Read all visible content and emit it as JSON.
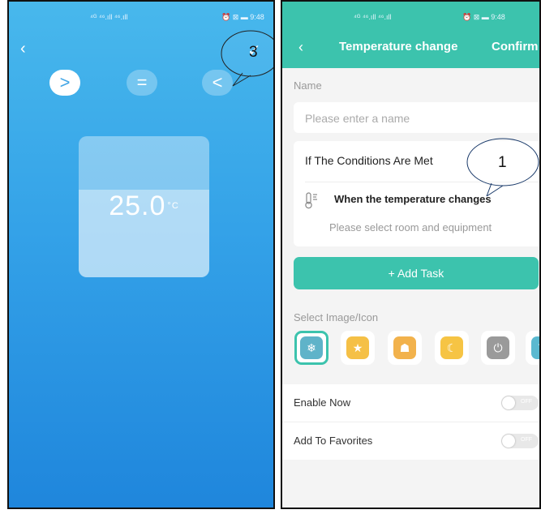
{
  "left_screen": {
    "status_bar": {
      "left": "⁴ᴳ ⁴⁶.ıll ⁴⁶.ıll",
      "right": "⏰ ⊠ ▬ 9:48"
    },
    "back_label": "‹",
    "operators": [
      {
        "symbol": ">",
        "selected": true
      },
      {
        "symbol": "=",
        "selected": false
      },
      {
        "symbol": "<",
        "selected": false
      }
    ],
    "confirm_check": "✓",
    "temperature": {
      "value": "25.0",
      "unit": "°C",
      "level_fraction": 0.62
    },
    "annotation": "3"
  },
  "right_screen": {
    "status_bar": {
      "left": "⁴ᴳ ⁴⁶.ıll ⁴⁶.ıll",
      "right": "⏰ ⊠ ▬ 9:48"
    },
    "header": {
      "back": "‹",
      "title": "Temperature change",
      "confirm": "Confirm"
    },
    "name_label": "Name",
    "name_placeholder": "Please enter a name",
    "conditions": {
      "title": "If The Conditions Are Met",
      "item_text": "When the temperature changes",
      "subtext": "Please select room and equipment"
    },
    "annotation": "1",
    "add_task": "+ Add Task",
    "image_label": "Select Image/Icon",
    "icons": [
      {
        "name": "home-snowflake-icon",
        "glyph": "❄",
        "color": "#5fb3c9",
        "selected": true
      },
      {
        "name": "home-star-icon",
        "glyph": "★",
        "color": "#f5c046",
        "selected": false
      },
      {
        "name": "home-person-icon",
        "glyph": "☗",
        "color": "#f2b24c",
        "selected": false
      },
      {
        "name": "moon-icon",
        "glyph": "☾",
        "color": "#f6c444",
        "selected": false
      },
      {
        "name": "power-icon",
        "glyph": "⏻",
        "color": "#9a9a9a",
        "selected": false
      },
      {
        "name": "refresh-icon",
        "glyph": "↻",
        "color": "#5ab9d0",
        "selected": false
      }
    ],
    "enable_now": {
      "label": "Enable Now",
      "toggle": "OFF"
    },
    "add_favorites": {
      "label": "Add To Favorites",
      "toggle": "OFF"
    }
  }
}
